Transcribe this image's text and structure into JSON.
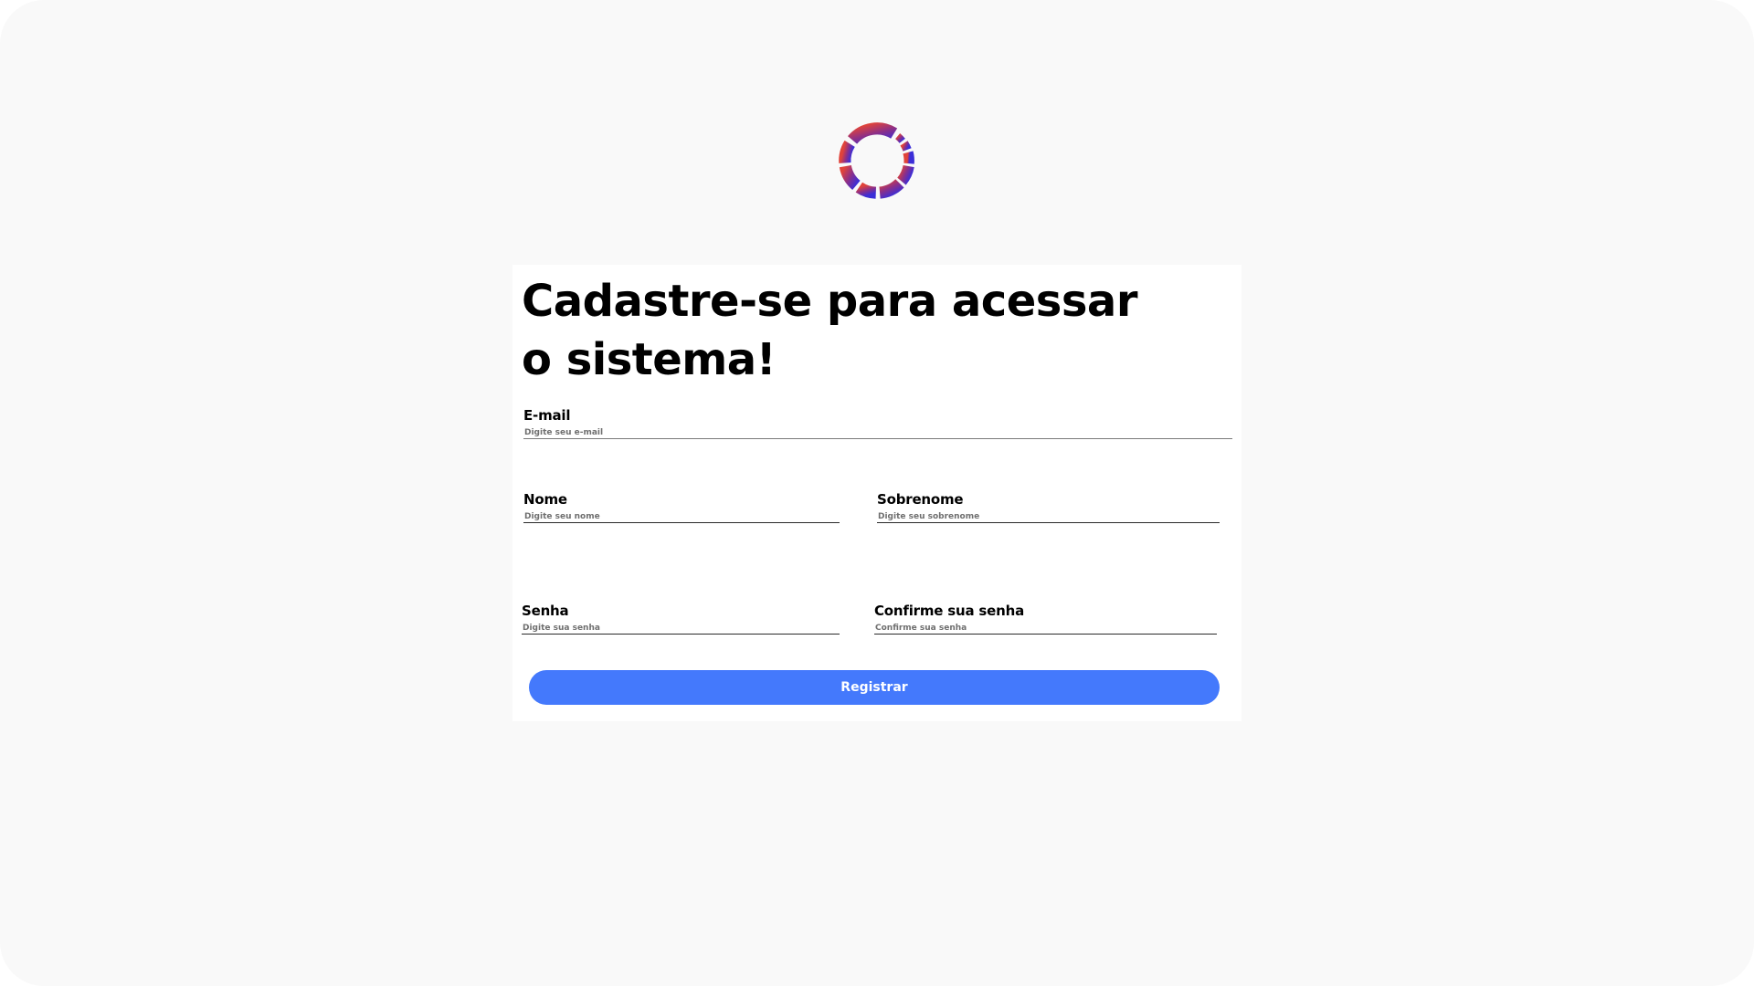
{
  "colors": {
    "page_background": "#f9f9f9",
    "card_background": "#ffffff",
    "primary_button": "#4479fc",
    "logo_gradient_start": "#d8443a",
    "logo_gradient_end": "#4b2ad1"
  },
  "logo": {
    "icon": "segmented-ring-logo-icon"
  },
  "form": {
    "title": "Cadastre-se para acessar o sistema!",
    "email": {
      "label": "E-mail",
      "placeholder": "Digite seu e-mail",
      "value": ""
    },
    "first_name": {
      "label": "Nome",
      "placeholder": "Digite seu nome",
      "value": ""
    },
    "last_name": {
      "label": "Sobrenome",
      "placeholder": "Digite seu sobrenome",
      "value": ""
    },
    "password": {
      "label": "Senha",
      "placeholder": "Digite sua senha",
      "value": ""
    },
    "confirm_password": {
      "label": "Confirme sua senha",
      "placeholder": "Confirme sua senha",
      "value": ""
    },
    "submit_label": "Registrar"
  }
}
